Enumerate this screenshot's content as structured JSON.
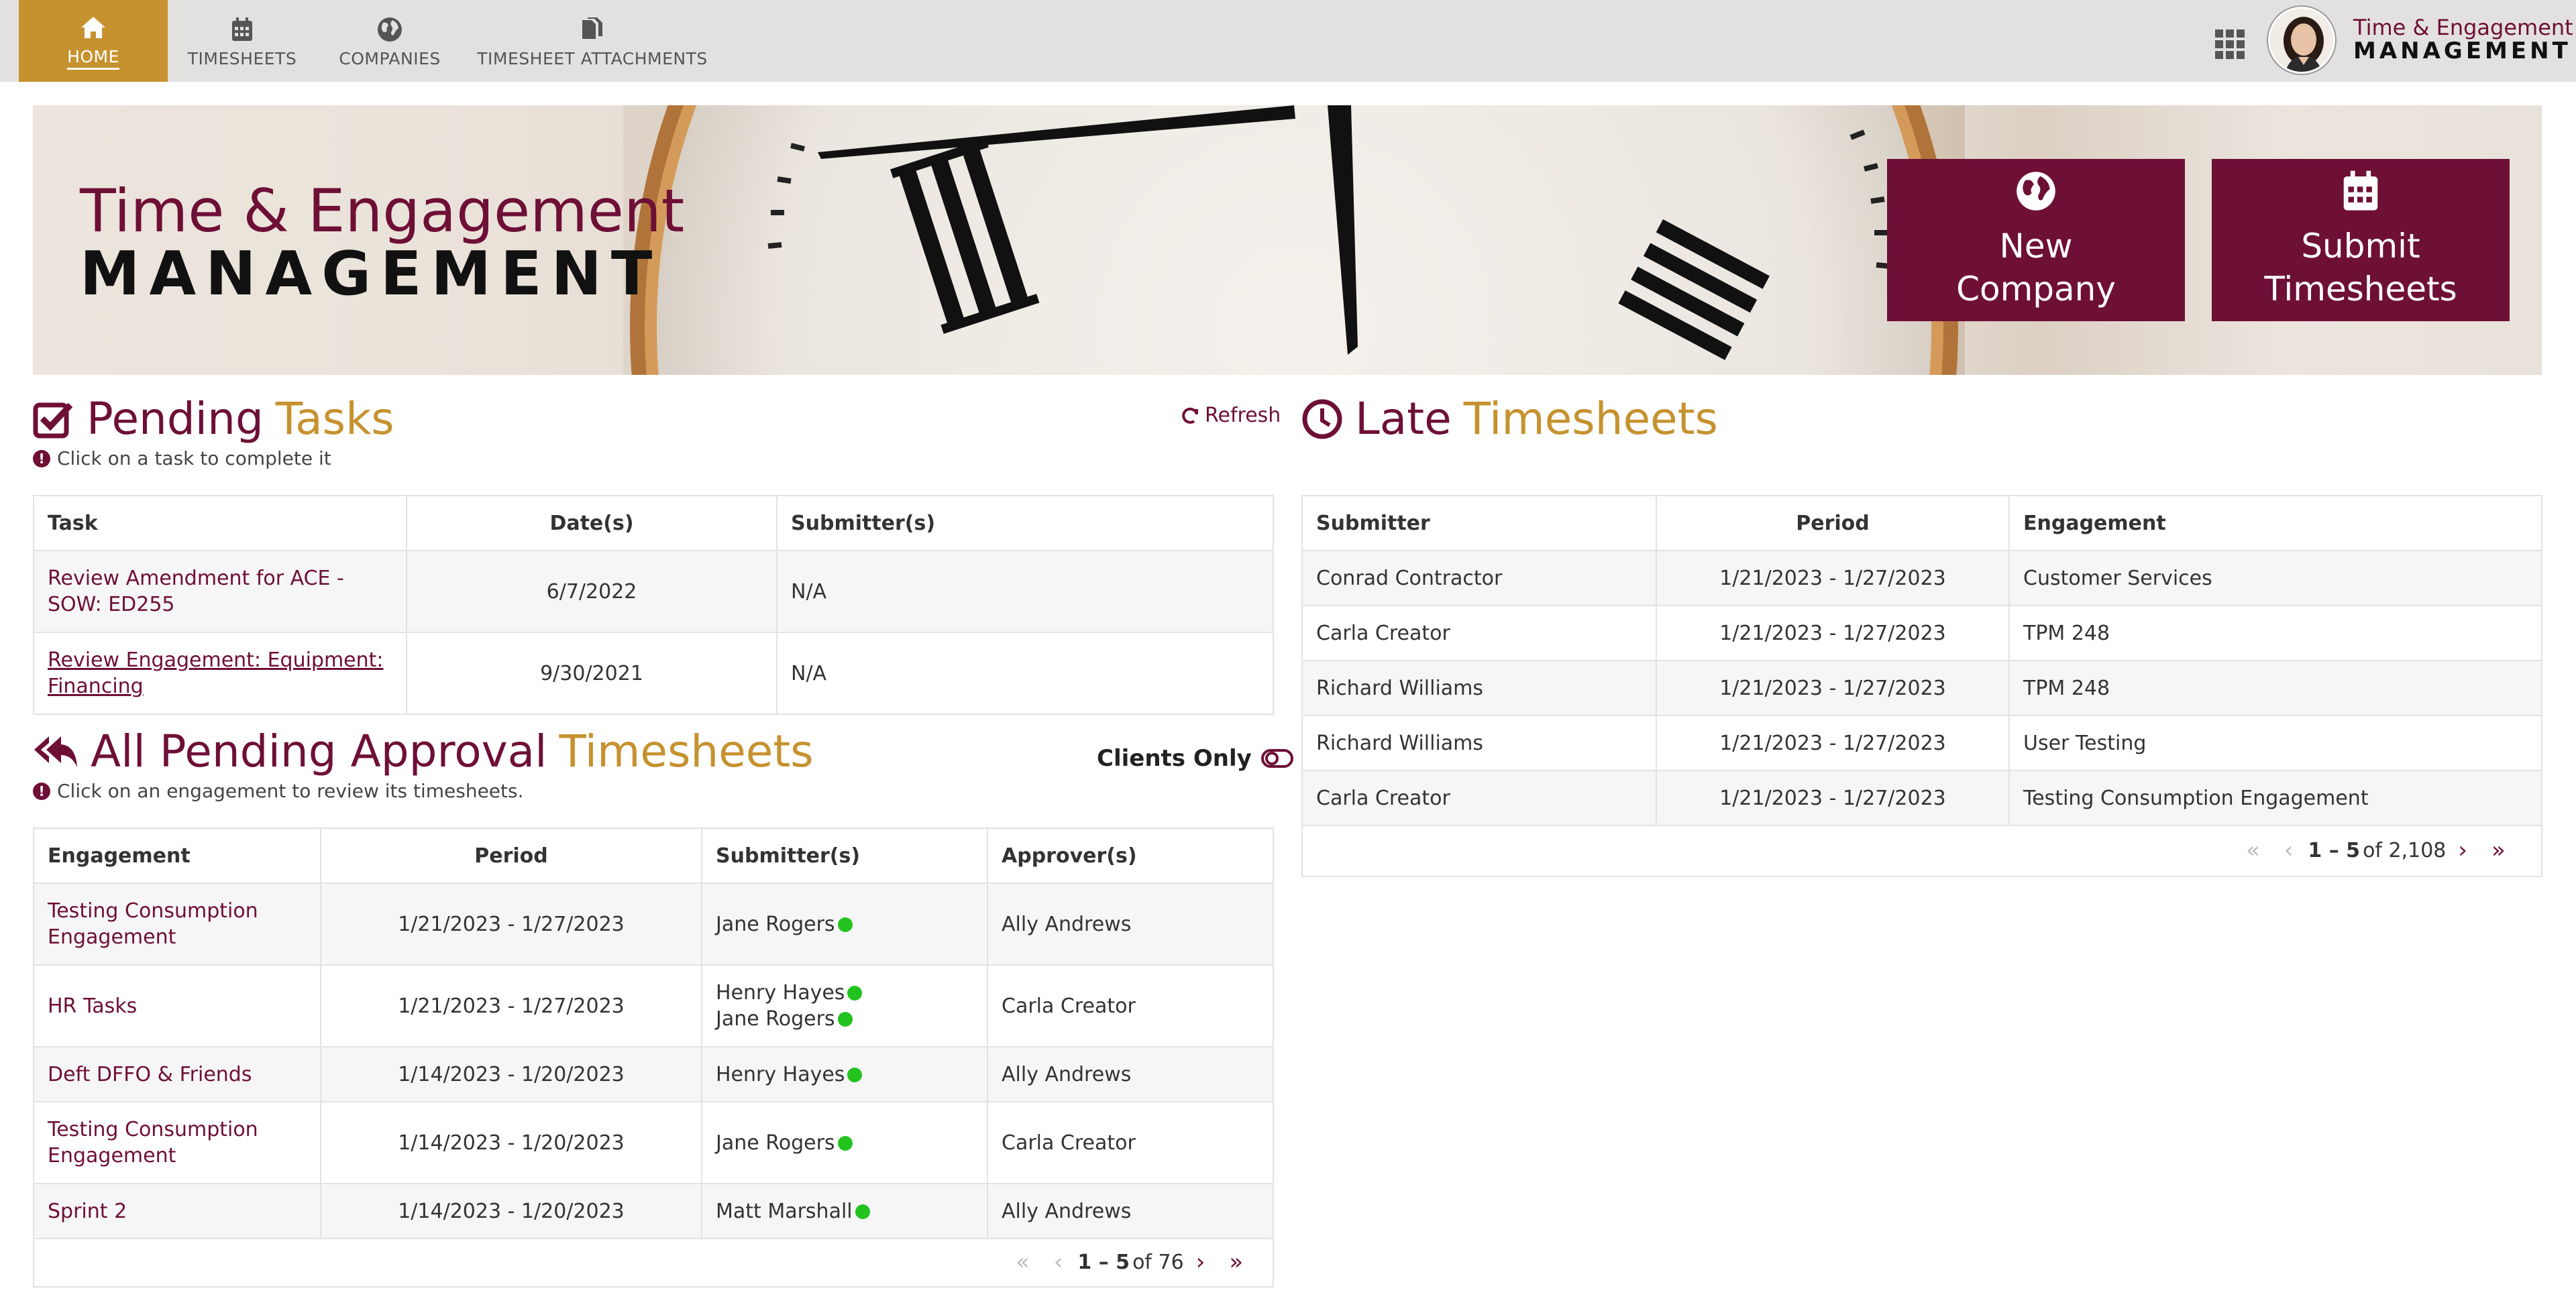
{
  "nav": {
    "items": [
      {
        "label": "HOME",
        "icon": "home-icon"
      },
      {
        "label": "TIMESHEETS",
        "icon": "calendar-icon"
      },
      {
        "label": "COMPANIES",
        "icon": "globe-icon"
      },
      {
        "label": "TIMESHEET ATTACHMENTS",
        "icon": "attachments-icon"
      }
    ],
    "active": "HOME"
  },
  "brand": {
    "line1": "Time & Engagement",
    "line2": "MANAGEMENT"
  },
  "banner": {
    "title_line1": "Time & Engagement",
    "title_line2": "MANAGEMENT",
    "new_company_label": "New\nCompany",
    "submit_timesheets_label": "Submit\nTimesheets"
  },
  "pending_tasks": {
    "title_a": "Pending",
    "title_b": "Tasks",
    "hint": "Click on a task to complete it",
    "refresh_label": "Refresh",
    "columns": [
      "Task",
      "Date(s)",
      "Submitter(s)"
    ],
    "rows": [
      {
        "task": "Review Amendment for ACE - SOW: ED255",
        "dates": "6/7/2022",
        "submitters": "N/A"
      },
      {
        "task": "Review Engagement: Equipment: Financing",
        "dates": "9/30/2021",
        "submitters": "N/A"
      }
    ]
  },
  "pending_approval": {
    "title_a": "All Pending Approval",
    "title_b": "Timesheets",
    "hint": "Click on an engagement to review its timesheets.",
    "clients_only_label": "Clients Only",
    "columns": [
      "Engagement",
      "Period",
      "Submitter(s)",
      "Approver(s)"
    ],
    "rows": [
      {
        "engagement": "Testing Consumption Engagement",
        "period": "1/21/2023 - 1/27/2023",
        "submitters": [
          "Jane Rogers"
        ],
        "approver": "Ally Andrews"
      },
      {
        "engagement": "HR Tasks",
        "period": "1/21/2023 - 1/27/2023",
        "submitters": [
          "Henry Hayes",
          "Jane Rogers"
        ],
        "approver": "Carla Creator"
      },
      {
        "engagement": "Deft DFFO & Friends",
        "period": "1/14/2023 - 1/20/2023",
        "submitters": [
          "Henry Hayes"
        ],
        "approver": "Ally Andrews"
      },
      {
        "engagement": "Testing Consumption Engagement",
        "period": "1/14/2023 - 1/20/2023",
        "submitters": [
          "Jane Rogers"
        ],
        "approver": "Carla Creator"
      },
      {
        "engagement": "Sprint 2",
        "period": "1/14/2023 - 1/20/2023",
        "submitters": [
          "Matt Marshall"
        ],
        "approver": "Ally Andrews"
      }
    ],
    "pager": {
      "range": "1 – 5",
      "of_label": "of 76"
    },
    "status_color": "#22c31f"
  },
  "late_timesheets": {
    "title_a": "Late",
    "title_b": "Timesheets",
    "columns": [
      "Submitter",
      "Period",
      "Engagement"
    ],
    "rows": [
      {
        "submitter": "Conrad Contractor",
        "period": "1/21/2023 - 1/27/2023",
        "engagement": "Customer Services"
      },
      {
        "submitter": "Carla Creator",
        "period": "1/21/2023 - 1/27/2023",
        "engagement": "TPM 248"
      },
      {
        "submitter": "Richard Williams",
        "period": "1/21/2023 - 1/27/2023",
        "engagement": "TPM 248"
      },
      {
        "submitter": "Richard Williams",
        "period": "1/21/2023 - 1/27/2023",
        "engagement": "User Testing"
      },
      {
        "submitter": "Carla Creator",
        "period": "1/21/2023 - 1/27/2023",
        "engagement": "Testing Consumption Engagement"
      }
    ],
    "pager": {
      "range": "1 – 5",
      "of_label": "of 2,108"
    }
  },
  "colors": {
    "brand_dark": "#6e0f36",
    "brand_gold": "#c6922f",
    "topbar": "#e3e1e0"
  }
}
